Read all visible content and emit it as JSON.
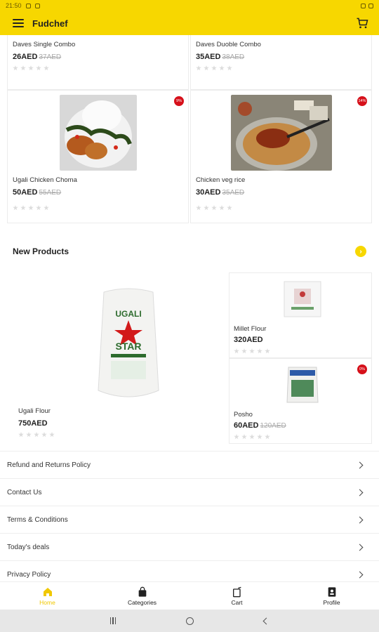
{
  "status_bar": {
    "time": "21:50"
  },
  "app": {
    "title": "Fudchef"
  },
  "top_products": [
    {
      "name": "Daves Single Combo",
      "price": "26AED",
      "old_price": "37AED"
    },
    {
      "name": "Daves Duoble Combo",
      "price": "35AED",
      "old_price": "38AED"
    }
  ],
  "deal_products": [
    {
      "name": "Ugali Chicken Choma",
      "price": "50AED",
      "old_price": "55AED",
      "badge": "9%"
    },
    {
      "name": "Chicken veg rice",
      "price": "30AED",
      "old_price": "35AED",
      "badge": "14%"
    }
  ],
  "new_products": {
    "title": "New Products",
    "featured": {
      "name": "Ugali Flour",
      "price": "750AED"
    },
    "items": [
      {
        "name": "Millet Flour",
        "price": "320AED",
        "old_price": ""
      },
      {
        "name": "Posho",
        "price": "60AED",
        "old_price": "120AED",
        "badge": "0%"
      }
    ]
  },
  "links": [
    "Refund and Returns Policy",
    "Contact Us",
    "Terms & Conditions",
    "Today's deals",
    "Privacy Policy"
  ],
  "bottom_nav": [
    {
      "label": "Home",
      "icon": "home-icon",
      "active": true
    },
    {
      "label": "Categories",
      "icon": "bag-icon",
      "active": false
    },
    {
      "label": "Cart",
      "icon": "cart-icon",
      "active": false
    },
    {
      "label": "Profile",
      "icon": "profile-icon",
      "active": false
    }
  ],
  "colors": {
    "accent": "#f7d700",
    "badge": "#d6101a"
  },
  "rating": 0
}
